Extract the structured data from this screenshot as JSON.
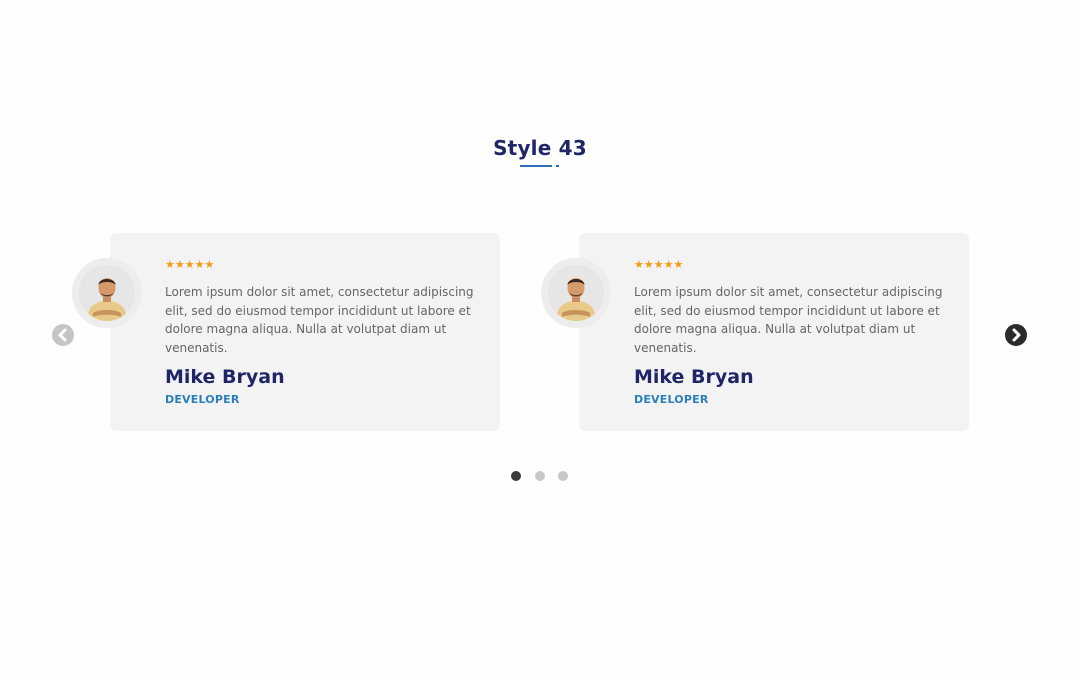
{
  "section": {
    "title": "Style 43"
  },
  "testimonials": [
    {
      "rating_stars": "★★★★★",
      "quote": "Lorem ipsum dolor sit amet, consectetur adipiscing elit, sed do eiusmod tempor incididunt ut labore et dolore magna aliqua. Nulla at volutpat diam ut venenatis.",
      "name": "Mike Bryan",
      "role": "DEVELOPER"
    },
    {
      "rating_stars": "★★★★★",
      "quote": "Lorem ipsum dolor sit amet, consectetur adipiscing elit, sed do eiusmod tempor incididunt ut labore et dolore magna aliqua. Nulla at volutpat diam ut venenatis.",
      "name": "Mike Bryan",
      "role": "DEVELOPER"
    }
  ],
  "carousel": {
    "prev_icon": "chevron-left-icon",
    "next_icon": "chevron-right-icon",
    "page_count": 3,
    "active_page": 1
  },
  "colors": {
    "title": "#1f2566",
    "accent": "#2a7fb8",
    "stars": "#f39c12",
    "card_bg": "#f3f3f3"
  }
}
